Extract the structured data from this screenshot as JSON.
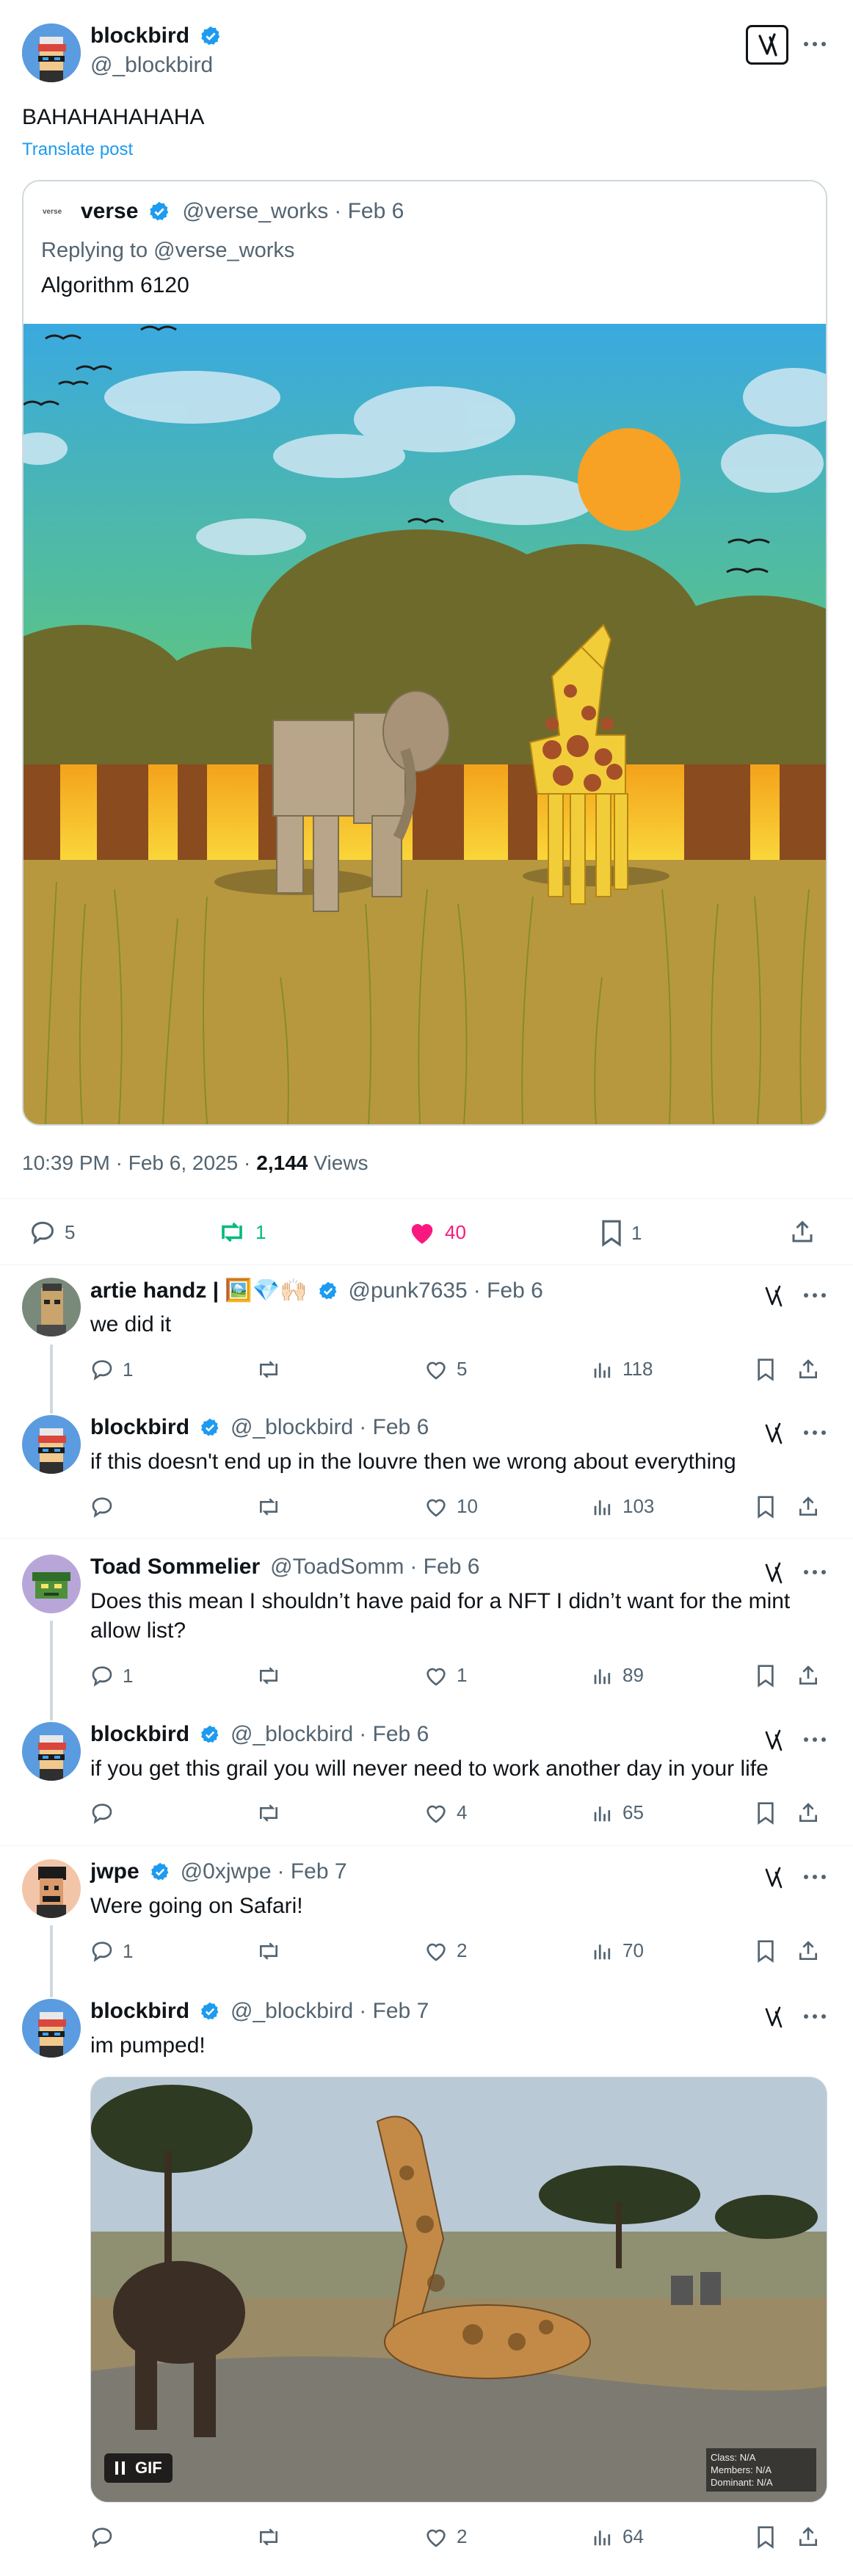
{
  "main_post": {
    "author_name": "blockbird",
    "author_handle": "@_blockbird",
    "text": "BAHAHAHAHAHA",
    "translate_label": "Translate post",
    "timestamp": "10:39 PM · Feb 6, 2025 ·",
    "views_count": "2,144",
    "views_label": "Views",
    "stats": {
      "replies": "5",
      "reposts": "1",
      "likes": "40",
      "bookmarks": "1"
    }
  },
  "quoted_post": {
    "logo_text": "verse",
    "author_name": "verse",
    "author_handle": "@verse_works",
    "date": "· Feb 6",
    "replying_to": "Replying to @verse_works",
    "text": "Algorithm 6120"
  },
  "replies": [
    {
      "name": "artie handz | 🖼️💎🙌🏻",
      "handle": "@punk7635",
      "date": "· Feb 6",
      "verified": true,
      "text": "we did it",
      "replies": "1",
      "likes": "5",
      "views": "118"
    },
    {
      "name": "blockbird",
      "handle": "@_blockbird",
      "date": "· Feb 6",
      "verified": true,
      "text": "if this doesn't end up in the louvre then we wrong about everything",
      "replies": "",
      "likes": "10",
      "views": "103"
    },
    {
      "name": "Toad Sommelier",
      "handle": "@ToadSomm",
      "date": "· Feb 6",
      "verified": false,
      "text": "Does this mean I shouldn’t have paid for a NFT I didn’t want for the mint allow list?",
      "replies": "1",
      "likes": "1",
      "views": "89"
    },
    {
      "name": "blockbird",
      "handle": "@_blockbird",
      "date": "· Feb 6",
      "verified": true,
      "text": "if you get this grail you will never need to work another day in your life",
      "replies": "",
      "likes": "4",
      "views": "65"
    },
    {
      "name": "jwpe",
      "handle": "@0xjwpe",
      "date": "· Feb 7",
      "verified": true,
      "text": "Were going on Safari!",
      "replies": "1",
      "likes": "2",
      "views": "70"
    },
    {
      "name": "blockbird",
      "handle": "@_blockbird",
      "date": "· Feb 7",
      "verified": true,
      "text": "im pumped!",
      "replies": "",
      "likes": "2",
      "views": "64"
    }
  ],
  "gif": {
    "badge_label": "GIF",
    "overlay_text": "Class: N/A\nMembers: N/A\nDominant: N/A"
  },
  "colors": {
    "accent": "#1d9bf0",
    "like": "#f91880",
    "repost": "#00ba7c",
    "muted": "#536471"
  }
}
